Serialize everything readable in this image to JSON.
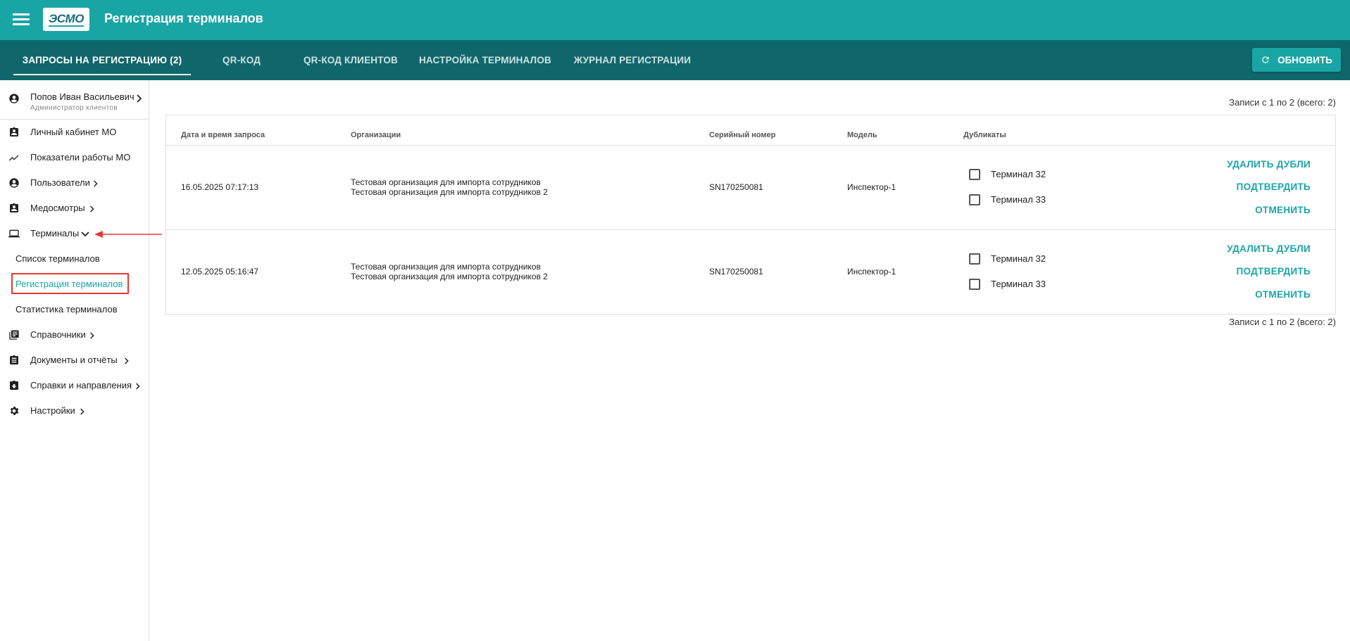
{
  "app": {
    "title": "Регистрация терминалов",
    "logo_text": "ЭСМО",
    "brand_color": "#1aa5a5",
    "tabbar_color": "#10676a"
  },
  "tabs": [
    {
      "label": "ЗАПРОСЫ НА РЕГИСТРАЦИЮ (2)",
      "active": true
    },
    {
      "label": "QR-КОД",
      "active": false
    },
    {
      "label": "QR-КОД КЛИЕНТОВ",
      "active": false
    },
    {
      "label": "НАСТРОЙКА ТЕРМИНАЛОВ",
      "active": false
    },
    {
      "label": "ЖУРНАЛ РЕГИСТРАЦИИ",
      "active": false
    }
  ],
  "toolbar": {
    "refresh_label": "ОБНОВИТЬ",
    "refresh_icon": "refresh-icon"
  },
  "user": {
    "name": "Попов Иван Васильевич",
    "role": "Администратор клиентов"
  },
  "sidebar": {
    "items": [
      {
        "label": "Личный кабинет МО",
        "icon": "badge-icon"
      },
      {
        "label": "Показатели работы МО",
        "icon": "trending-icon"
      },
      {
        "label": "Пользователи",
        "icon": "account-circle-icon"
      },
      {
        "label": "Медосмотры",
        "icon": "badge-icon"
      },
      {
        "label": "Терминалы",
        "icon": "laptop-icon"
      },
      {
        "label": "Справочники",
        "icon": "library-books-icon"
      },
      {
        "label": "Документы и отчёты",
        "icon": "clipboard-icon"
      },
      {
        "label": "Справки и направления",
        "icon": "clipboard-download-icon"
      },
      {
        "label": "Настройки",
        "icon": "gear-icon"
      }
    ],
    "terminal_subitems": [
      {
        "label": "Список терминалов",
        "active": false
      },
      {
        "label": "Регистрация терминалов",
        "active": true
      },
      {
        "label": "Статистика терминалов",
        "active": false
      }
    ]
  },
  "records_label": "Записи с 1 по 2 (всего: 2)",
  "table": {
    "headers": [
      "Дата и время запроса",
      "Организации",
      "Серийный номер",
      "Модель",
      "Дубликаты"
    ],
    "rows": [
      {
        "datetime": "16.05.2025 07:17:13",
        "org1": "Тестовая организация для импорта сотрудников",
        "org2": "Тестовая организация для импорта сотрудников 2",
        "serial": "SN170250081",
        "model": "Инспектор-1",
        "dup1": "Терминал 32",
        "dup2": "Терминал 33"
      },
      {
        "datetime": "12.05.2025 05:16:47",
        "org1": "Тестовая организация для импорта сотрудников",
        "org2": "Тестовая организация для импорта сотрудников 2",
        "serial": "SN170250081",
        "model": "Инспектор-1",
        "dup1": "Терминал 32",
        "dup2": "Терминал 33"
      }
    ],
    "actions": {
      "delete_dups": "УДАЛИТЬ ДУБЛИ",
      "confirm": "ПОДТВЕРДИТЬ",
      "cancel": "ОТМЕНИТЬ"
    }
  }
}
